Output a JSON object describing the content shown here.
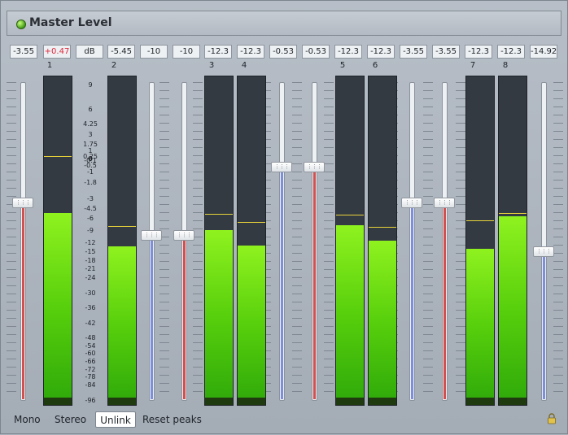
{
  "window": {
    "title": "Master Level"
  },
  "readouts": [
    "-3.55",
    "+0.47",
    "dB",
    "-5.45",
    "-10",
    "-10",
    "-12.3",
    "-12.3",
    "-0.53",
    "-0.53",
    "-12.3",
    "-12.3",
    "-3.55",
    "-3.55",
    "-12.3",
    "-12.3",
    "-14.92"
  ],
  "readout_colors": {
    "normal": "#202429",
    "clip": "#e0263a"
  },
  "channels": [
    {
      "label": "1",
      "level_db": -5.0,
      "peak_db": 0.47
    },
    {
      "label": "2",
      "level_db": -12.8,
      "peak_db": -7.5
    },
    {
      "label": "3",
      "level_db": -8.5,
      "peak_db": -5.1
    },
    {
      "label": "4",
      "level_db": -12.6,
      "peak_db": -6.5
    },
    {
      "label": "5",
      "level_db": -7.4,
      "peak_db": -5.2
    },
    {
      "label": "6",
      "level_db": -11.2,
      "peak_db": -7.8
    },
    {
      "label": "7",
      "level_db": -13.7,
      "peak_db": -6.2
    },
    {
      "label": "8",
      "level_db": -5.5,
      "peak_db": -5.0
    }
  ],
  "faders": [
    {
      "color": "red",
      "value_db": -3.55
    },
    {
      "color": "blue",
      "value_db": -10
    },
    {
      "color": "red",
      "value_db": -10
    },
    {
      "color": "blue",
      "value_db": -0.53
    },
    {
      "color": "red",
      "value_db": -0.53
    },
    {
      "color": "blue",
      "value_db": -3.55
    },
    {
      "color": "red",
      "value_db": -3.55
    },
    {
      "color": "blue",
      "value_db": -14.92
    }
  ],
  "scale": [
    "9",
    "6",
    "4.25",
    "3",
    "1.75",
    "1",
    "0.25",
    "0",
    "-0.1",
    "-0.5",
    "-1",
    "-1.8",
    "-3",
    "-4.5",
    "-6",
    "-9",
    "-12",
    "-15",
    "-18",
    "-21",
    "-24",
    "-30",
    "-36",
    "-42",
    "-48",
    "-54",
    "-60",
    "-66",
    "-72",
    "-78",
    "-84",
    "-96"
  ],
  "buttons": {
    "mono": "Mono",
    "stereo": "Stereo",
    "unlink": "Unlink",
    "reset_peaks": "Reset peaks"
  },
  "icons": {
    "status": "green-led-icon",
    "lock": "lock-icon",
    "fader_grip": "grip-icon"
  }
}
